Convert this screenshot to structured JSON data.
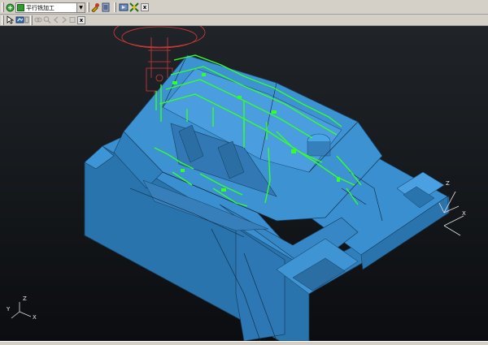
{
  "toolbar": {
    "operation_select": {
      "value": "平行铣加工"
    },
    "close_label": "x",
    "icons": [
      "strategy-icon",
      "operation-icon",
      "tool-icon",
      "database-icon",
      "simulate-icon",
      "verify-icon",
      "close-icon"
    ]
  },
  "toolbar2": {
    "close_label": "x",
    "icons": [
      "pointer-icon",
      "pan-icon",
      "view-icon",
      "link-icon",
      "arrow-left-icon",
      "arrow-right-icon",
      "zoom-icon",
      "close-icon"
    ]
  },
  "viewport": {
    "background_top": "#202428",
    "background_bottom": "#0b0d10",
    "model_color": "#3d8fcf",
    "toolpath_color": "#35ff2a",
    "axis_labels": {
      "x": "X",
      "y": "Y",
      "z": "Z"
    }
  }
}
